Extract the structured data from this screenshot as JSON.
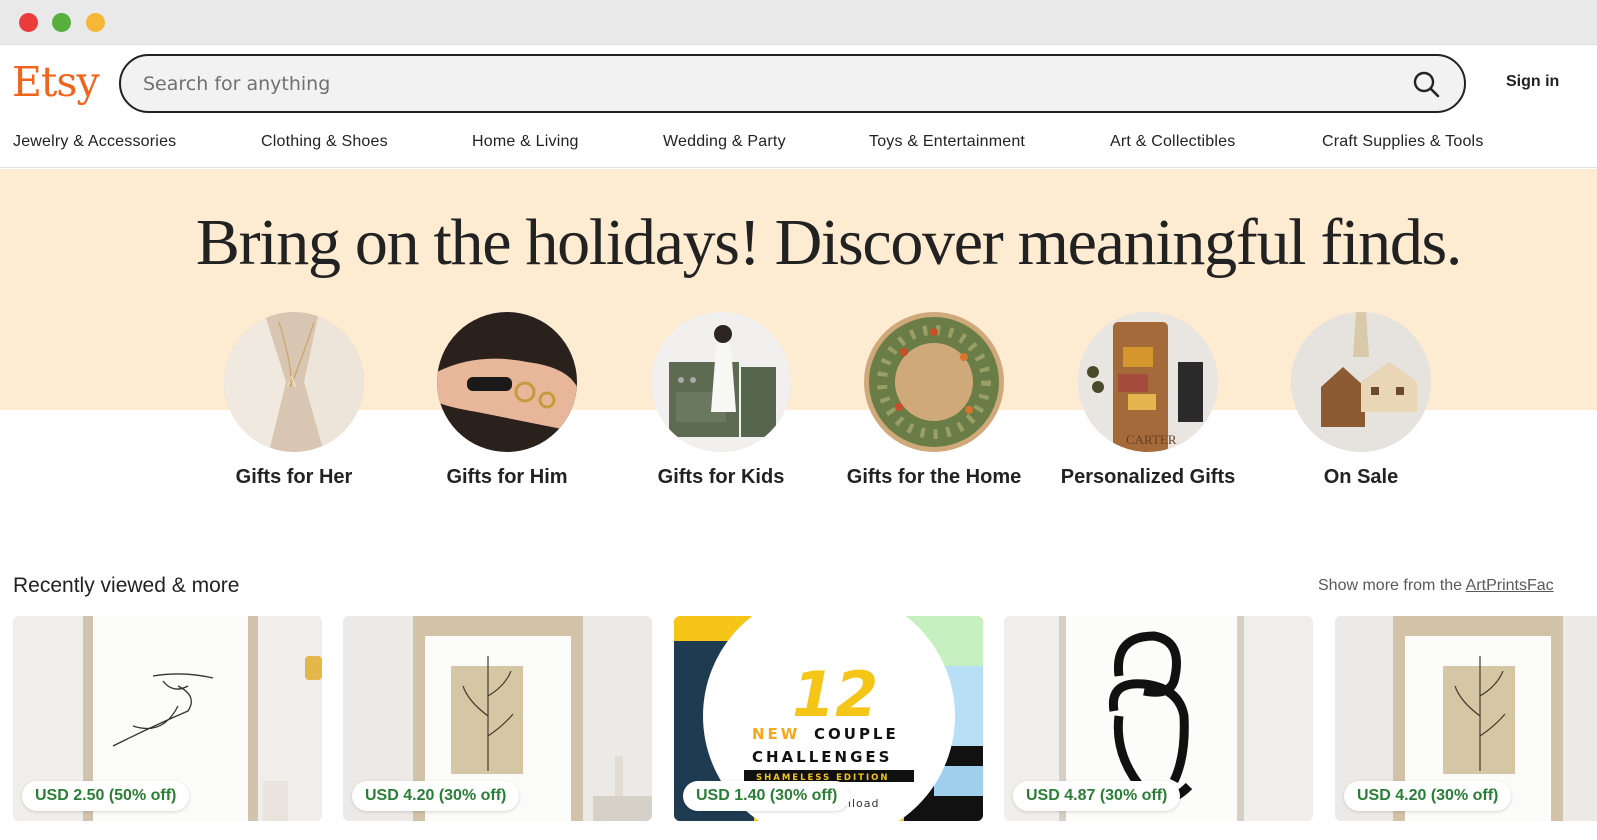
{
  "brand": {
    "logo": "Etsy",
    "accent": "#f1641e"
  },
  "search": {
    "placeholder": "Search for anything",
    "value": ""
  },
  "header": {
    "sign_in": "Sign in"
  },
  "nav": {
    "items": [
      "Jewelry & Accessories",
      "Clothing & Shoes",
      "Home & Living",
      "Wedding & Party",
      "Toys & Entertainment",
      "Art & Collectibles",
      "Craft Supplies & Tools"
    ]
  },
  "hero": {
    "title": "Bring on the holidays! Discover meaningful finds.",
    "background": "#fdebd2",
    "categories": [
      {
        "label": "Gifts for Her"
      },
      {
        "label": "Gifts for Him"
      },
      {
        "label": "Gifts for Kids"
      },
      {
        "label": "Gifts for the Home"
      },
      {
        "label": "Personalized Gifts"
      },
      {
        "label": "On Sale"
      }
    ]
  },
  "recent": {
    "title": "Recently viewed & more",
    "more_prefix": "Show more from the ",
    "more_link": "ArtPrintsFac",
    "cards": [
      {
        "price": "USD 2.50 (50% off)"
      },
      {
        "price": "USD 4.20 (30% off)"
      },
      {
        "price": "USD 1.40 (30% off)",
        "badge_number": "12",
        "badge_line1_a": "NEW",
        "badge_line1_b": "COUPLE",
        "badge_line2": "CHALLENGES",
        "badge_line3": "SHAMELESS EDITION",
        "badge_line4": "nload"
      },
      {
        "price": "USD 4.87 (30% off)"
      },
      {
        "price": "USD 4.20 (30% off)"
      }
    ],
    "price_color": "#2b7e35"
  }
}
